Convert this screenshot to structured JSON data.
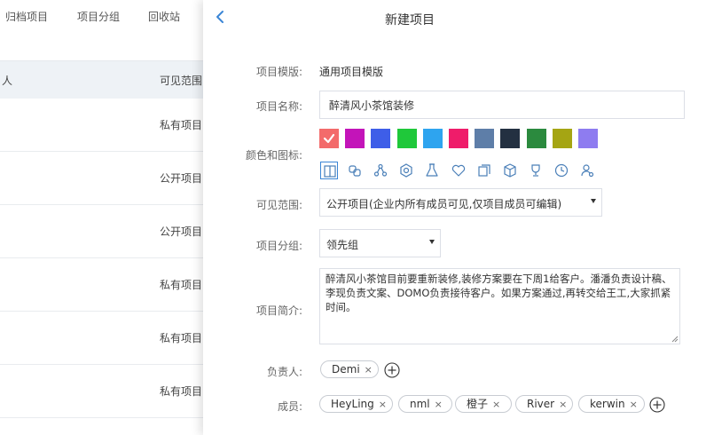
{
  "background": {
    "tabs": [
      "归档项目",
      "项目分组",
      "回收站"
    ],
    "header": {
      "col1": "人",
      "col2": "可见范围"
    },
    "rows": [
      "私有项目",
      "公开项目",
      "公开项目",
      "私有项目",
      "私有项目",
      "私有项目"
    ]
  },
  "drawer": {
    "title": "新建项目",
    "template": {
      "label": "项目模版:",
      "value": "通用项目模版"
    },
    "name": {
      "label": "项目名称:",
      "value": "醉清风小茶馆装修"
    },
    "color_icon": {
      "label": "颜色和图标:",
      "colors": [
        "#f36b6b",
        "#c314b9",
        "#3e5ee8",
        "#1fc83a",
        "#2ea4ef",
        "#ef1c6a",
        "#5e7ea8",
        "#233041",
        "#2b8a3e",
        "#a5a513",
        "#8e7cf0"
      ],
      "selected_color": 0,
      "icons": [
        "book-icon",
        "link-icon",
        "nodes-icon",
        "hexagon-icon",
        "flask-icon",
        "heart-icon",
        "copy-icon",
        "cube-icon",
        "trophy-icon",
        "clock-icon",
        "user-settings-icon"
      ],
      "selected_icon": 0
    },
    "visibility": {
      "label": "可见范围:",
      "value": "公开项目(企业内所有成员可见,仅项目成员可编辑)"
    },
    "group": {
      "label": "项目分组:",
      "value": "领先组"
    },
    "desc": {
      "label": "项目简介:",
      "value": "醉清风小茶馆目前要重新装修,装修方案要在下周1给客户。潘潘负责设计稿、李现负责文案、DOMO负责接待客户。如果方案通过,再转交给王工,大家抓紧时间。"
    },
    "owner": {
      "label": "负责人:",
      "tags": [
        "Demi"
      ]
    },
    "members": {
      "label": "成员:",
      "tags": [
        "HeyLing",
        "nml",
        "橙子",
        "River",
        "kerwin"
      ]
    },
    "accent": "#3b86d6"
  }
}
